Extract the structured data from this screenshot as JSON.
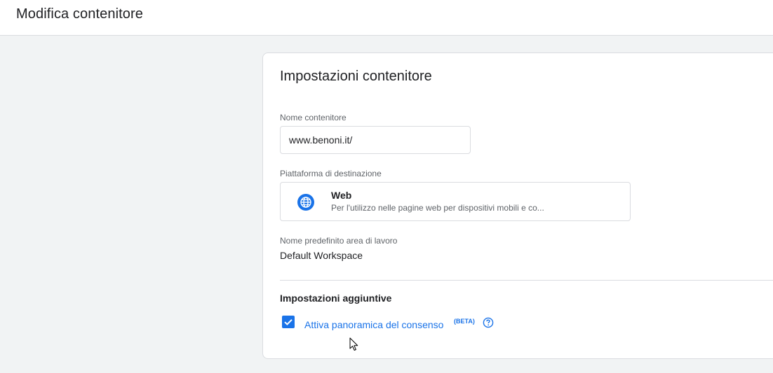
{
  "header": {
    "title": "Modifica contenitore"
  },
  "card": {
    "title": "Impostazioni contenitore",
    "container_name": {
      "label": "Nome contenitore",
      "value": "www.benoni.it/"
    },
    "target_platform": {
      "label": "Piattaforma di destinazione",
      "icon": "globe-icon",
      "name": "Web",
      "description": "Per l'utilizzo nelle pagine web per dispositivi mobili e co..."
    },
    "workspace": {
      "label": "Nome predefinito area di lavoro",
      "value": "Default Workspace"
    },
    "additional": {
      "title": "Impostazioni aggiuntive",
      "consent_label": "Attiva panoramica del consenso",
      "beta": "(BETA)",
      "checked": true
    }
  },
  "colors": {
    "accent": "#1a73e8",
    "background": "#f1f3f4",
    "border": "#dadce0"
  }
}
